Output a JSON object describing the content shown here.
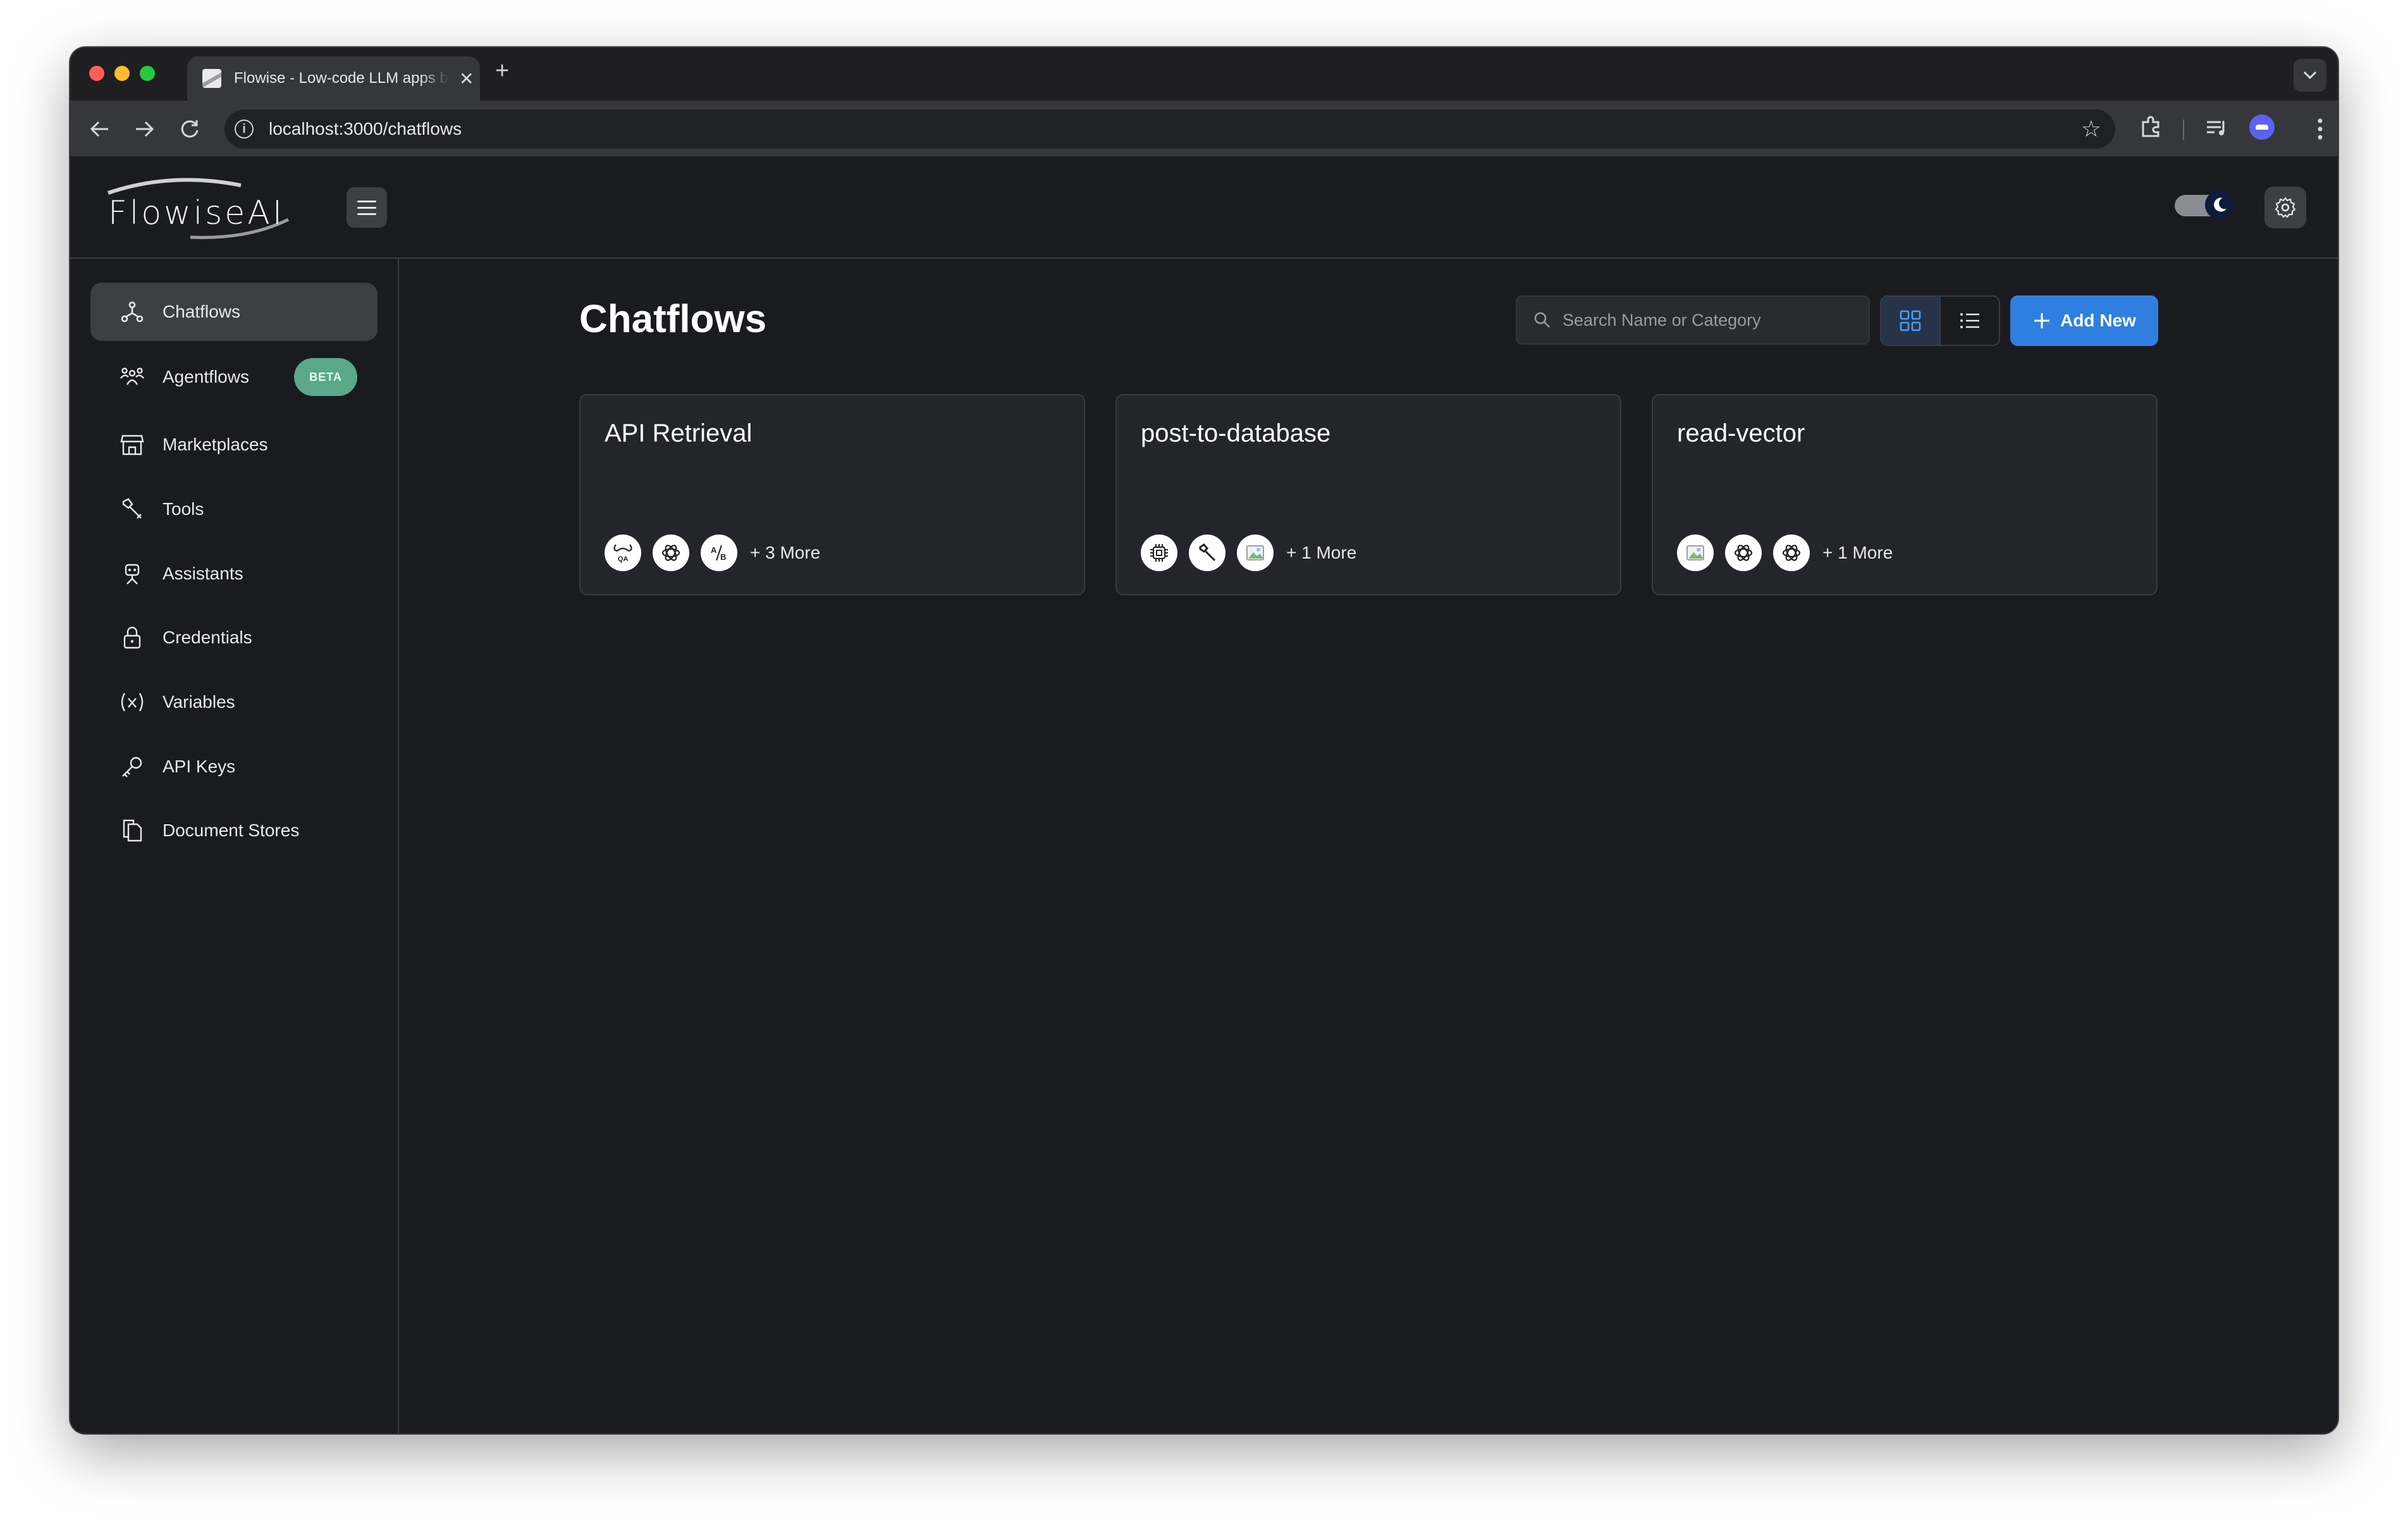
{
  "browser": {
    "tab_title": "Flowise - Low-code LLM apps builder",
    "tab_close": "✕",
    "new_tab": "+",
    "url": "localhost:3000/chatflows"
  },
  "app": {
    "logo_text": "FlowiseAI",
    "sidebar": {
      "items": [
        {
          "label": "Chatflows",
          "icon": "chatflow-icon",
          "active": true
        },
        {
          "label": "Agentflows",
          "icon": "agentflow-icon",
          "badge": "BETA"
        },
        {
          "label": "Marketplaces",
          "icon": "marketplace-icon"
        },
        {
          "label": "Tools",
          "icon": "tools-icon"
        },
        {
          "label": "Assistants",
          "icon": "assistant-icon"
        },
        {
          "label": "Credentials",
          "icon": "lock-icon"
        },
        {
          "label": "Variables",
          "icon": "variable-icon"
        },
        {
          "label": "API Keys",
          "icon": "key-icon"
        },
        {
          "label": "Document Stores",
          "icon": "document-stores-icon"
        }
      ]
    },
    "main": {
      "title": "Chatflows",
      "search_placeholder": "Search Name or Category",
      "add_new_label": "Add New",
      "view_mode": "grid",
      "cards": [
        {
          "title": "API Retrieval",
          "icons": [
            "qa-chain-icon",
            "openai-icon",
            "ab-icon"
          ],
          "more": "+ 3 More"
        },
        {
          "title": "post-to-database",
          "icons": [
            "chip-icon",
            "wrench-icon",
            "image-placeholder-icon"
          ],
          "more": "+ 1 More"
        },
        {
          "title": "read-vector",
          "icons": [
            "image-placeholder-icon",
            "openai-icon",
            "openai-icon"
          ],
          "more": "+ 1 More"
        }
      ]
    }
  },
  "colors": {
    "background": "#1a1b1f",
    "accent": "#2f7fe0",
    "beta_badge": "#5aa889",
    "active_item": "#3d3f46"
  }
}
